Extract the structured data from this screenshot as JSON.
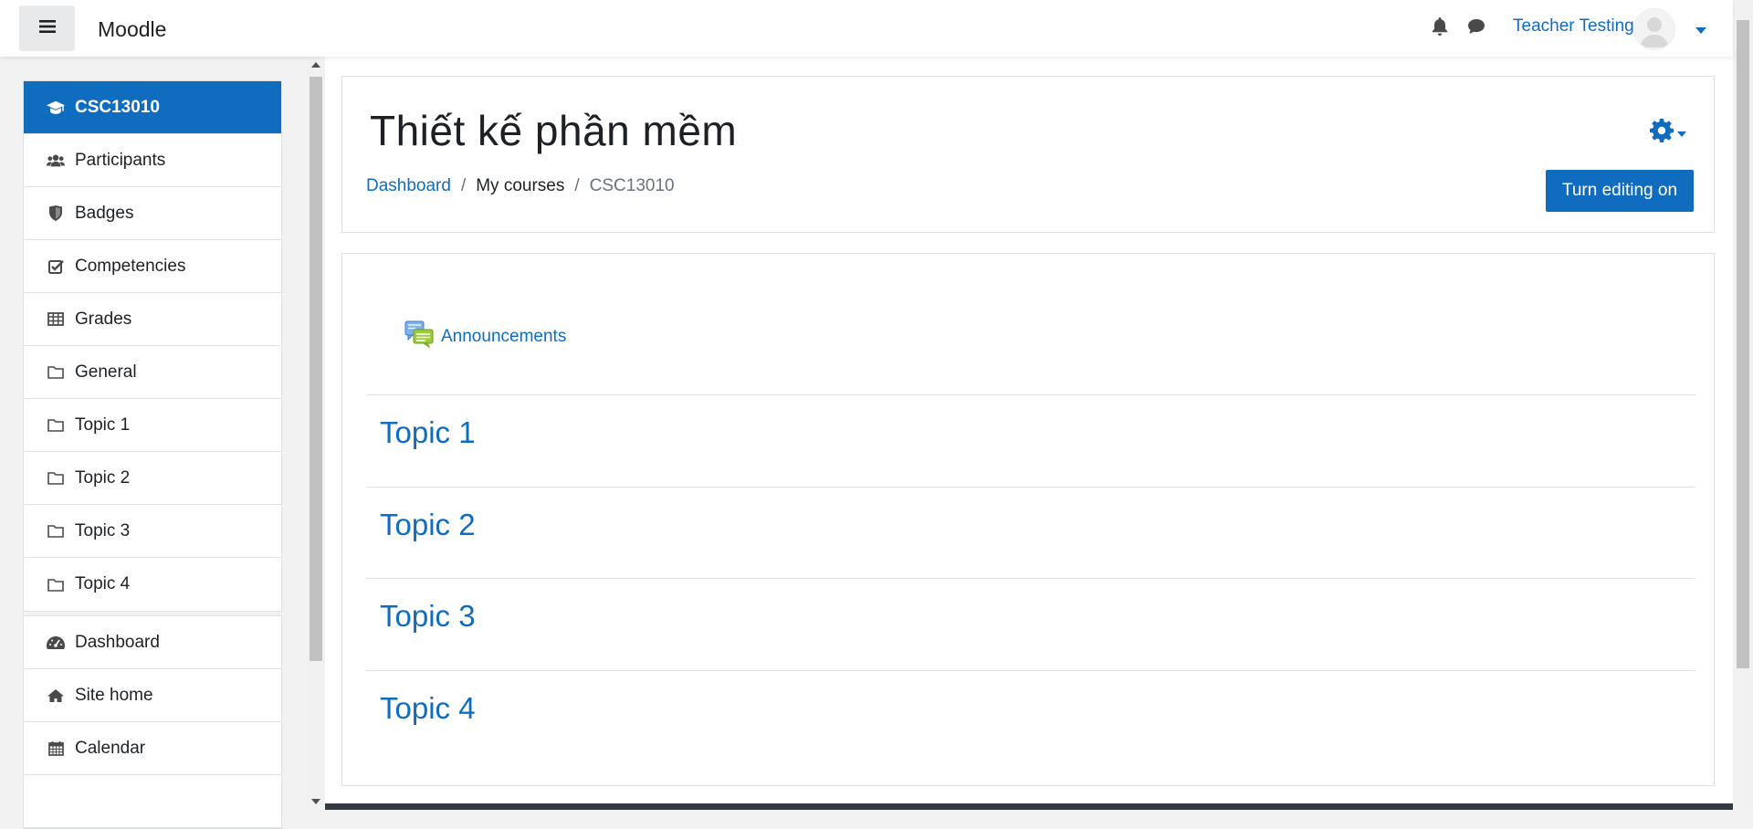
{
  "app": {
    "name": "Moodle"
  },
  "header": {
    "user_name": "Teacher Testing"
  },
  "drawer": {
    "course_items": [
      {
        "label": "CSC13010",
        "icon": "graduation-cap-icon",
        "active": true
      },
      {
        "label": "Participants",
        "icon": "users-icon"
      },
      {
        "label": "Badges",
        "icon": "shield-icon"
      },
      {
        "label": "Competencies",
        "icon": "checkbox-icon"
      },
      {
        "label": "Grades",
        "icon": "table-icon"
      },
      {
        "label": "General",
        "icon": "folder-icon"
      },
      {
        "label": "Topic 1",
        "icon": "folder-icon"
      },
      {
        "label": "Topic 2",
        "icon": "folder-icon"
      },
      {
        "label": "Topic 3",
        "icon": "folder-icon"
      },
      {
        "label": "Topic 4",
        "icon": "folder-icon"
      }
    ],
    "site_items": [
      {
        "label": "Dashboard",
        "icon": "dashboard-icon"
      },
      {
        "label": "Site home",
        "icon": "home-icon"
      },
      {
        "label": "Calendar",
        "icon": "calendar-icon"
      }
    ]
  },
  "page": {
    "title": "Thiết kế phần mềm",
    "breadcrumb": [
      "Dashboard",
      "My courses",
      "CSC13010"
    ],
    "edit_button": "Turn editing on"
  },
  "course": {
    "announcement": "Announcements",
    "sections": [
      "Topic 1",
      "Topic 2",
      "Topic 3",
      "Topic 4"
    ]
  },
  "colors": {
    "primary": "#0f6cbf",
    "text": "#1d2125",
    "muted": "#6a737b",
    "border": "#dee2e6",
    "background": "#f2f2f2"
  }
}
